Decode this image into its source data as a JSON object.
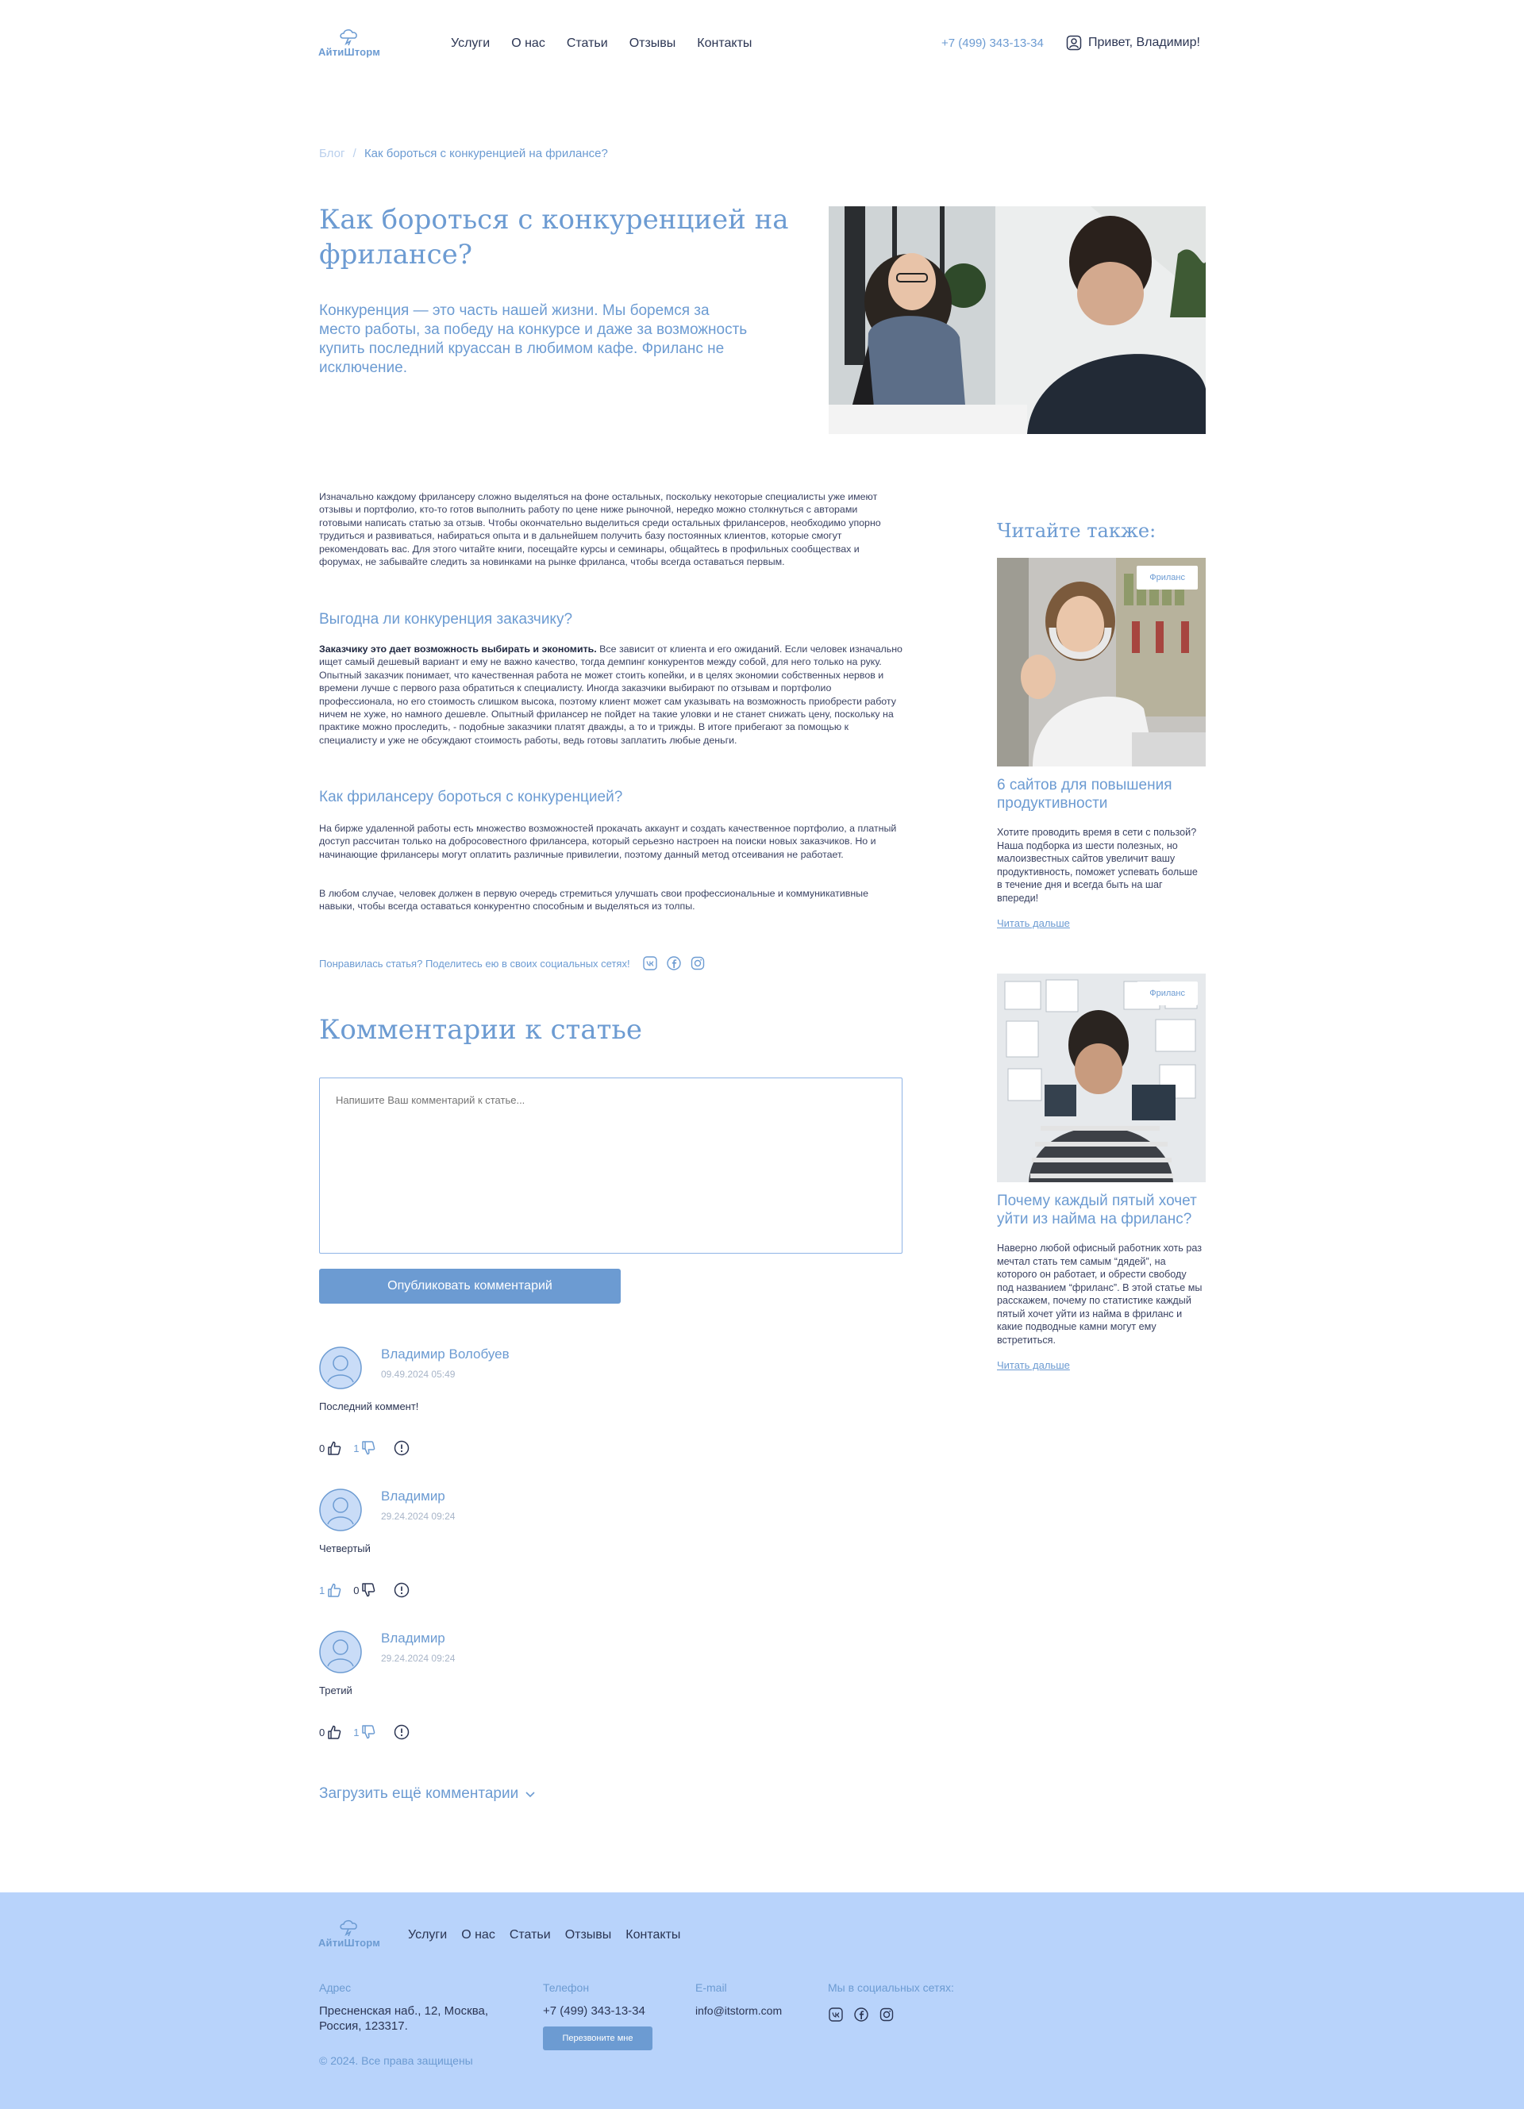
{
  "header": {
    "logo_text": "АйтиШторм",
    "nav": [
      "Услуги",
      "О нас",
      "Статьи",
      "Отзывы",
      "Контакты"
    ],
    "phone": "+7 (499) 343-13-34",
    "greeting": "Привет, Владимир!"
  },
  "breadcrumb": {
    "blog": "Блог",
    "separator": "/",
    "current": "Как бороться с конкуренцией на фрилансе?"
  },
  "article": {
    "title": "Как бороться с конкуренцией на фрилансе?",
    "lead": "Конкуренция — это часть нашей жизни. Мы боремся за место работы, за победу на конкурсе и даже за возможность купить последний круассан в любимом кафе. Фриланс не исключение.",
    "intro": "Изначально каждому фрилансеру сложно выделяться на фоне остальных, поскольку некоторые специалисты уже имеют отзывы и портфолио, кто-то готов выполнить работу по цене ниже рыночной, нередко можно столкнуться с авторами готовыми написать статью за отзыв. Чтобы окончательно выделиться среди остальных фрилансеров, необходимо упорно трудиться и развиваться, набираться опыта и в дальнейшем получить базу постоянных клиентов, которые смогут рекомендовать вас. Для этого читайте книги, посещайте курсы и семинары, общайтесь в профильных сообществах и форумах, не забывайте следить за новинками на рынке фриланса, чтобы всегда оставаться первым.",
    "section1_title": "Выгодна ли конкуренция заказчику?",
    "section1_bold": "Заказчику это дает возможность выбирать и экономить.",
    "section1_text": " Все зависит от клиента и его ожиданий. Если человек изначально ищет самый дешевый вариант и ему не важно качество, тогда демпинг конкурентов между собой, для него только на руку. Опытный заказчик понимает, что качественная работа не может стоить копейки, и в целях экономии собственных нервов и времени лучше с первого раза обратиться к специалисту. Иногда заказчики выбирают по отзывам и портфолио профессионала, но его стоимость слишком высока, поэтому клиент может сам указывать на возможность приобрести работу ничем не хуже, но намного дешевле. Опытный фрилансер не пойдет на такие уловки и не станет снижать цену, поскольку на практике можно проследить, - подобные заказчики платят дважды, а то и трижды. В итоге прибегают за помощью к специалисту и уже не обсуждают стоимость работы, ведь готовы заплатить любые деньги.",
    "section2_title": "Как фрилансеру бороться с конкуренцией?",
    "section2_p1": "На бирже удаленной работы есть множество возможностей прокачать аккаунт и создать качественное портфолио, а платный доступ рассчитан только на добросовестного фрилансера, который серьезно настроен на поиски новых заказчиков. Но и начинающие фрилансеры могут оплатить различные привилегии, поэтому данный метод отсеивания не работает.",
    "section2_p2": "В любом случае, человек должен в первую очередь стремиться улучшать свои профессиональные и коммуникативные навыки, чтобы всегда оставаться конкурентно способным и выделяться из толпы.",
    "share_text": "Понравилась статья? Поделитесь ею в своих социальных сетях!"
  },
  "comments": {
    "title": "Комментарии к статье",
    "placeholder": "Напишите Ваш комментарий к статье...",
    "publish_label": "Опубликовать комментарий",
    "items": [
      {
        "name": "Владимир Волобуев",
        "date": "09.49.2024 05:49",
        "text": "Последний коммент!",
        "likes": "0",
        "dislikes": "1"
      },
      {
        "name": "Владимир",
        "date": "29.24.2024 09:24",
        "text": "Четвертый",
        "likes": "1",
        "dislikes": "0"
      },
      {
        "name": "Владимир",
        "date": "29.24.2024 09:24",
        "text": "Третий",
        "likes": "0",
        "dislikes": "1"
      }
    ],
    "load_more": "Загрузить ещё комментарии"
  },
  "sidebar": {
    "title": "Читайте также:",
    "cards": [
      {
        "tag": "Фриланс",
        "title": "6 сайтов для повышения продуктивности",
        "text": "Хотите проводить время в сети с пользой? Наша подборка из шести полезных, но малоизвестных сайтов увеличит вашу продуктивность, поможет успевать больше в течение дня и всегда быть на шаг впереди!",
        "link": "Читать дальше"
      },
      {
        "tag": "Фриланс",
        "title": "Почему каждый пятый хочет уйти из найма на фриланс?",
        "text": "Наверно любой офисный работник хоть раз мечтал стать тем самым “дядей”, на которого он работает, и обрести свободу под названием “фриланс”. В этой статье мы расскажем, почему по статистике каждый пятый хочет уйти из найма в фриланс и какие подводные камни могут ему встретиться.",
        "link": "Читать дальше"
      }
    ]
  },
  "footer": {
    "logo_text": "АйтиШторм",
    "nav": [
      "Услуги",
      "О нас",
      "Статьи",
      "Отзывы",
      "Контакты"
    ],
    "address_label": "Адрес",
    "address": "Пресненская наб., 12, Москва, Россия, 123317.",
    "phone_label": "Телефон",
    "phone": "+7 (499) 343-13-34",
    "callback_label": "Перезвоните мне",
    "email_label": "E-mail",
    "email": "info@itstorm.com",
    "social_label": "Мы в социальных сетях:",
    "copyright": "© 2024. Все права защищены"
  },
  "colors": {
    "accent": "#6c9bd2",
    "footer_bg": "#b8d3fb",
    "text": "#2b3553"
  }
}
